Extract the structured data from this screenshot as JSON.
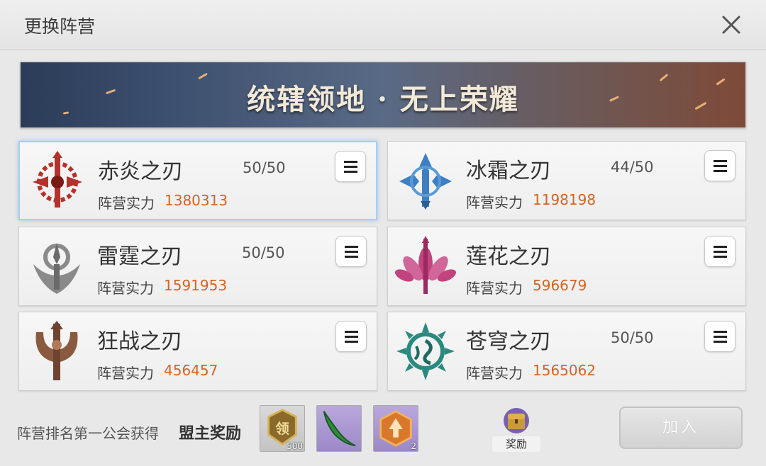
{
  "window": {
    "title": "更换阵营"
  },
  "banner": {
    "text": "统辖领地 · 无上荣耀"
  },
  "factions": [
    {
      "name": "赤炎之刃",
      "count": "50/50",
      "power_label": "阵营实力",
      "power": "1380313",
      "emblem_color": "#b3322b",
      "selected": true
    },
    {
      "name": "冰霜之刃",
      "count": "44/50",
      "power_label": "阵营实力",
      "power": "1198198",
      "emblem_color": "#3d7fc2",
      "selected": false
    },
    {
      "name": "雷霆之刃",
      "count": "50/50",
      "power_label": "阵营实力",
      "power": "1591953",
      "emblem_color": "#8a8a8a",
      "selected": false
    },
    {
      "name": "莲花之刃",
      "count": "",
      "power_label": "阵营实力",
      "power": "596679",
      "emblem_color": "#c2447f",
      "selected": false
    },
    {
      "name": "狂战之刃",
      "count": "",
      "power_label": "阵营实力",
      "power": "456457",
      "emblem_color": "#8a5a40",
      "selected": false
    },
    {
      "name": "苍穹之刃",
      "count": "50/50",
      "power_label": "阵营实力",
      "power": "1565062",
      "emblem_color": "#2b8a7f",
      "selected": false
    }
  ],
  "footer": {
    "ranking_text": "阵营排名第一公会获得",
    "reward_title": "盟主奖励",
    "items": [
      {
        "icon": "leader-badge-icon",
        "glyph": "领",
        "count": "500"
      },
      {
        "icon": "green-horn-icon",
        "count": ""
      },
      {
        "icon": "orange-hexagon-icon",
        "count": "2"
      }
    ],
    "reward_button_label": "奖励",
    "join_button_label": "加入"
  },
  "colors": {
    "power_value": "#d8621f",
    "selected_border": "#a9cdf0"
  }
}
